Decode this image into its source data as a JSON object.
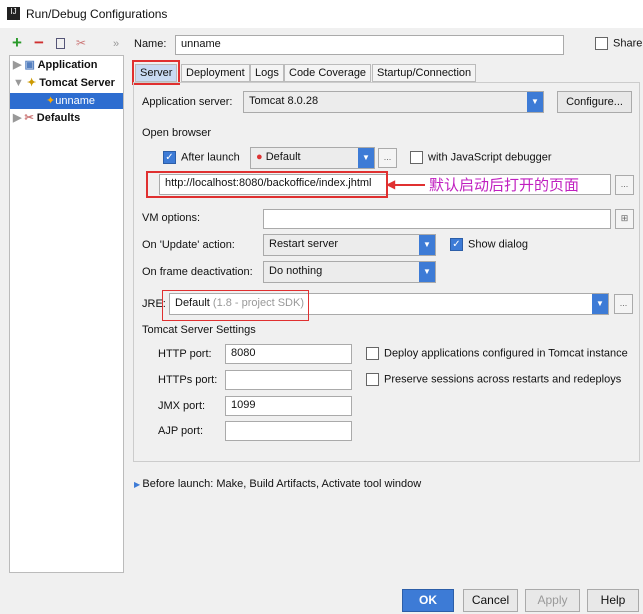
{
  "window": {
    "title": "Run/Debug Configurations"
  },
  "toolbar": {
    "add": "+",
    "remove": "−",
    "more": "»"
  },
  "tree": [
    {
      "label": "Application"
    },
    {
      "label": "Tomcat Server"
    },
    {
      "label": "unname"
    },
    {
      "label": "Defaults"
    }
  ],
  "name": {
    "label": "Name:",
    "value": "unname"
  },
  "share": {
    "label": "Share"
  },
  "tabs": [
    "Server",
    "Deployment",
    "Logs",
    "Code Coverage",
    "Startup/Connection"
  ],
  "server": {
    "app_server_label": "Application server:",
    "app_server": "Tomcat 8.0.28",
    "configure": "Configure..."
  },
  "browser": {
    "section": "Open browser",
    "after_launch": "After launch",
    "browser": "Default",
    "js_debugger": "with JavaScript debugger",
    "url": "http://localhost:8080/backoffice/index.jhtml",
    "annotation": "默认启动后打开的页面"
  },
  "vm": {
    "label": "VM options:"
  },
  "update": {
    "label": "On 'Update' action:",
    "value": "Restart server",
    "show_dialog": "Show dialog"
  },
  "frame": {
    "label": "On frame deactivation:",
    "value": "Do nothing"
  },
  "jre": {
    "label": "JRE:",
    "value": "Default",
    "hint": "(1.8 - project SDK)"
  },
  "tomcat": {
    "section": "Tomcat Server Settings",
    "http_label": "HTTP port:",
    "http": "8080",
    "https_label": "HTTPs port:",
    "https": "",
    "jmx_label": "JMX port:",
    "jmx": "1099",
    "ajp_label": "AJP port:",
    "ajp": "",
    "deploy": "Deploy applications configured in Tomcat instance",
    "preserve": "Preserve sessions across restarts and redeploys"
  },
  "before_launch": "Before launch: Make, Build Artifacts, Activate tool window",
  "buttons": {
    "ok": "OK",
    "cancel": "Cancel",
    "apply": "Apply",
    "help": "Help"
  }
}
